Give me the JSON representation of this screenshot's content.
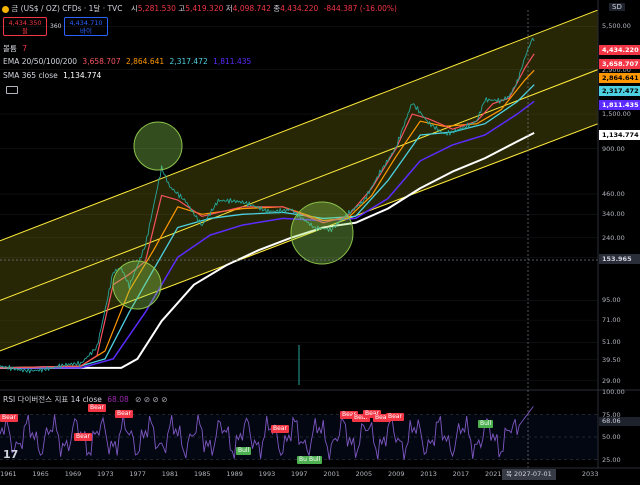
{
  "header": {
    "title": "금 (US$ / OZ) CFDs · 1달 · TVC",
    "ohlc": [
      {
        "k": "시",
        "v": "5,281.530"
      },
      {
        "k": "고",
        "v": "5,419.320"
      },
      {
        "k": "저",
        "v": "4,098.742"
      },
      {
        "k": "종",
        "v": "4,434.220"
      }
    ],
    "change": "-844.387 (-16.00%)",
    "sell_price": "4,434.350",
    "sell_label": "팔",
    "spread": "360",
    "buy_price": "4,434.710",
    "buy_label": "바이",
    "currency_badge": "SD"
  },
  "indicators": {
    "volume": {
      "label": "볼륨",
      "value": "7"
    },
    "ema": {
      "label": "EMA 20/50/100/200",
      "values": [
        {
          "v": "3,658.707",
          "c": "#f7525f"
        },
        {
          "v": "2,864.641",
          "c": "#ff9800"
        },
        {
          "v": "2,317.472",
          "c": "#4dd0e1"
        },
        {
          "v": "1,811.435",
          "c": "#5c2bff"
        }
      ]
    },
    "sma": {
      "label": "SMA 365 close",
      "value": "1,134.774"
    },
    "rsi": {
      "label": "RSI 다이버전스 지표 14 close",
      "value": "68.08"
    }
  },
  "price_axis": {
    "ticks": [
      "5,500.00",
      "2,900.00",
      "1,500.00",
      "900.00",
      "460.00",
      "340.00",
      "240.00",
      "180.00",
      "95.00",
      "71.00",
      "51.00",
      "39.50",
      "29.00"
    ],
    "labels": [
      {
        "text": "4,434.220",
        "bg": "#f23645",
        "fg": "#ffffff"
      },
      {
        "text": "3,658.707",
        "bg": "#f23645",
        "fg": "#ffffff"
      },
      {
        "text": "2,864.641",
        "bg": "#ff9800",
        "fg": "#000000"
      },
      {
        "text": "2,317.472",
        "bg": "#4dd0e1",
        "fg": "#000000"
      },
      {
        "text": "1,811.435",
        "bg": "#5c2bff",
        "fg": "#ffffff"
      },
      {
        "text": "1,134.774",
        "bg": "#ffffff",
        "fg": "#000000"
      },
      {
        "text": "153.965",
        "bg": "#2a2e39",
        "fg": "#d1d4dc"
      }
    ]
  },
  "rsi_axis": {
    "ticks": [
      "100.00",
      "75.00",
      "50.00",
      "25.00"
    ],
    "current": "68.06"
  },
  "time_axis": {
    "ticks": [
      "1961",
      "1965",
      "1969",
      "1973",
      "1977",
      "1981",
      "1985",
      "1989",
      "1993",
      "1997",
      "2001",
      "2005",
      "2009",
      "2013",
      "2017",
      "2021",
      "2025",
      "2033"
    ],
    "crosshair_label": "목 2027-07-01"
  },
  "divergence_labels": [
    {
      "text": "Bear",
      "type": "bear"
    },
    {
      "text": "Bear",
      "type": "bear"
    },
    {
      "text": "Bear",
      "type": "bear"
    },
    {
      "text": "Bear",
      "type": "bear"
    },
    {
      "text": "Bear",
      "type": "bear"
    },
    {
      "text": "Bear",
      "type": "bear"
    },
    {
      "text": "Bear",
      "type": "bear"
    },
    {
      "text": "Bear",
      "type": "bear"
    },
    {
      "text": "Bear",
      "type": "bear"
    },
    {
      "text": "Bear",
      "type": "bear"
    },
    {
      "text": "Bull",
      "type": "bull"
    },
    {
      "text": "Bull",
      "type": "bull"
    },
    {
      "text": "Bull",
      "type": "bull"
    },
    {
      "text": "Bull",
      "type": "bull"
    }
  ],
  "tv_logo": "17",
  "chart_data": {
    "type": "line",
    "title": "",
    "x_range": [
      "1960",
      "2034"
    ],
    "y_scale": "log",
    "ylim": [
      26,
      7000
    ],
    "series": [
      {
        "name": "price",
        "color": "#26a69a",
        "x": [
          1960,
          1967,
          1970,
          1972,
          1974,
          1975,
          1976,
          1978,
          1980,
          1981,
          1983,
          1985,
          1987,
          1990,
          1993,
          1996,
          1999,
          2001,
          2003,
          2005,
          2007,
          2009,
          2011,
          2013,
          2015,
          2017,
          2019,
          2020,
          2022,
          2023,
          2024,
          2025,
          2025.7,
          2026.1
        ],
        "y": [
          35,
          35,
          36,
          48,
          150,
          160,
          120,
          210,
          650,
          500,
          420,
          300,
          420,
          390,
          360,
          380,
          270,
          260,
          340,
          430,
          650,
          900,
          1700,
          1300,
          1150,
          1250,
          1350,
          1800,
          1750,
          1900,
          2400,
          3600,
          4300,
          4434
        ]
      },
      {
        "name": "EMA 20",
        "color": "#f7525f",
        "x": [
          1960,
          1970,
          1972,
          1974,
          1976,
          1978,
          1980,
          1982,
          1985,
          1990,
          1995,
          2000,
          2003,
          2006,
          2009,
          2011,
          2013,
          2016,
          2019,
          2021,
          2023,
          2025,
          2026.1
        ],
        "y": [
          35,
          36,
          42,
          120,
          140,
          170,
          450,
          420,
          330,
          380,
          380,
          300,
          330,
          500,
          900,
          1500,
          1400,
          1200,
          1350,
          1750,
          1900,
          3000,
          3659
        ]
      },
      {
        "name": "EMA 50",
        "color": "#ff9800",
        "x": [
          1960,
          1970,
          1973,
          1976,
          1979,
          1982,
          1985,
          1990,
          1995,
          2000,
          2003,
          2006,
          2009,
          2012,
          2015,
          2019,
          2022,
          2025,
          2026.1
        ],
        "y": [
          35,
          36,
          45,
          110,
          200,
          380,
          340,
          370,
          380,
          310,
          320,
          450,
          800,
          1350,
          1250,
          1300,
          1600,
          2500,
          2865
        ]
      },
      {
        "name": "EMA 100",
        "color": "#4dd0e1",
        "x": [
          1960,
          1970,
          1973,
          1976,
          1979,
          1982,
          1986,
          1990,
          1995,
          2000,
          2004,
          2008,
          2012,
          2016,
          2020,
          2024,
          2026.1
        ],
        "y": [
          35,
          36,
          40,
          80,
          150,
          280,
          320,
          340,
          350,
          320,
          330,
          560,
          1100,
          1150,
          1300,
          1800,
          2317
        ]
      },
      {
        "name": "EMA 200",
        "color": "#5c2bff",
        "x": [
          1960,
          1970,
          1974,
          1978,
          1982,
          1986,
          1990,
          1995,
          2000,
          2004,
          2008,
          2012,
          2016,
          2020,
          2024,
          2026.1
        ],
        "y": [
          35,
          35,
          40,
          80,
          180,
          250,
          290,
          320,
          310,
          320,
          430,
          750,
          950,
          1100,
          1500,
          1811
        ]
      },
      {
        "name": "SMA 365",
        "color": "#ffffff",
        "x": [
          1960,
          1975,
          1977,
          1980,
          1984,
          1988,
          1992,
          1996,
          2000,
          2004,
          2008,
          2012,
          2016,
          2020,
          2024,
          2026.1
        ],
        "y": [
          35,
          35,
          40,
          70,
          120,
          160,
          200,
          240,
          280,
          300,
          370,
          500,
          640,
          780,
          1000,
          1135
        ]
      }
    ],
    "channel_lines": [
      {
        "x": [
          1960,
          2034
        ],
        "y": [
          230,
          7000
        ],
        "color": "#ffeb3b"
      },
      {
        "x": [
          1960,
          2034
        ],
        "y": [
          95,
          2900
        ],
        "color": "#ffeb3b"
      },
      {
        "x": [
          1960,
          2034
        ],
        "y": [
          45,
          1300
        ],
        "color": "#ffeb3b"
      }
    ],
    "rsi": {
      "name": "RSI 14",
      "ylim": [
        20,
        100
      ],
      "levels": [
        75,
        50,
        25
      ]
    }
  }
}
